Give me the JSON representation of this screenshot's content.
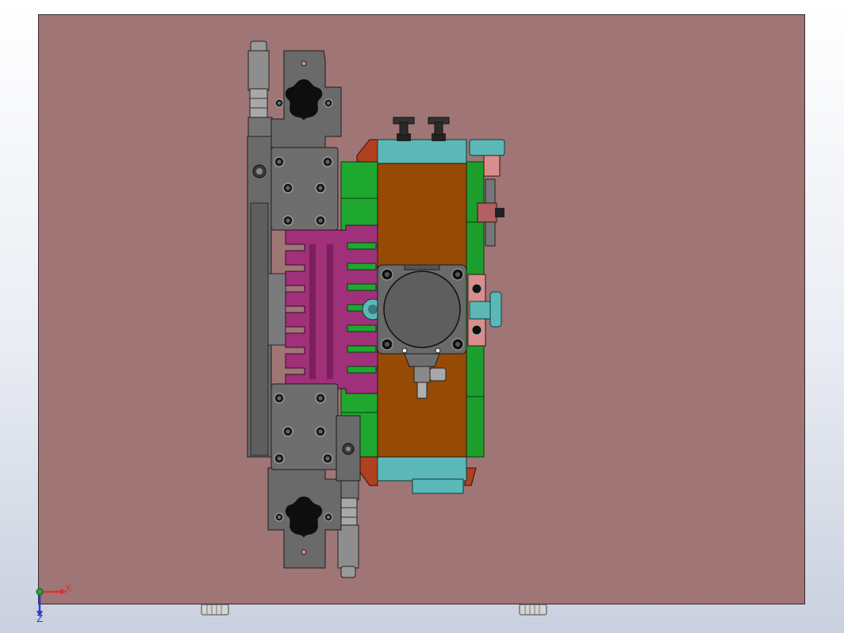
{
  "viewport": {
    "background_top": "#ffffff",
    "background_bottom": "#c9d0de"
  },
  "colors": {
    "plate": "#a07575",
    "steel_dark": "#5a5a5a",
    "steel_mid": "#6e6e6e",
    "steel_light": "#8c8c8c",
    "green": "#1ea830",
    "brown": "#964a05",
    "teal": "#5cb8b8",
    "magenta": "#a0307a",
    "pink": "#d98e8e",
    "red": "#b02020",
    "black": "#151515"
  },
  "icons": {
    "triad": "coordinate-triad-icon",
    "knob": "star-knob-icon",
    "bolt": "socket-head-bolt-icon"
  },
  "triad": {
    "x_label": "X",
    "z_label": "Z"
  }
}
